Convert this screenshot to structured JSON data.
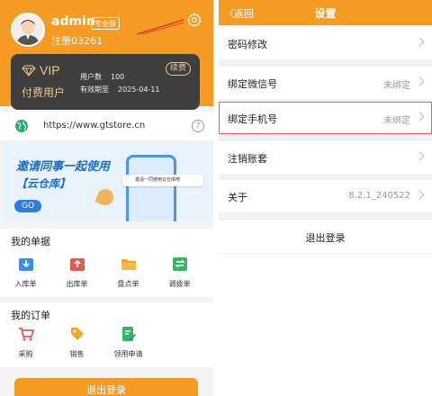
{
  "left": {
    "user": {
      "name": "admin",
      "edition": "专业版",
      "reg_no": "注册03261"
    },
    "vip": {
      "title": "VIP",
      "subtitle": "付费用户",
      "users_label": "用户数",
      "users_value": "100",
      "expire_label": "有效期至",
      "expire_value": "2025-04-11",
      "renew_label": "续费"
    },
    "url": "https://www.gtstore.cn",
    "help_glyph": "?",
    "banner": {
      "line1": "邀请同事一起使用",
      "line2": "【云仓库】",
      "go_label": "GO",
      "tip": "邀请一同使用云仓库吧"
    },
    "documents": {
      "title": "我的单据",
      "items": [
        {
          "label": "入库单",
          "icon": "inbound-icon",
          "color": "#3a8ee6"
        },
        {
          "label": "出库单",
          "icon": "outbound-icon",
          "color": "#e05a4f"
        },
        {
          "label": "盘点单",
          "icon": "folder-icon",
          "color": "#f5a623"
        },
        {
          "label": "调拨单",
          "icon": "transfer-icon",
          "color": "#3bb26b"
        }
      ]
    },
    "orders": {
      "title": "我的订单",
      "items": [
        {
          "label": "采购",
          "icon": "cart-icon",
          "color": "#e05a4f"
        },
        {
          "label": "销售",
          "icon": "tag-icon",
          "color": "#f5a623"
        },
        {
          "label": "领用申请",
          "icon": "edit-doc-icon",
          "color": "#3bb26b"
        }
      ]
    },
    "logout_label": "退出登录"
  },
  "right": {
    "back_label": "返回",
    "title": "设置",
    "rows": [
      {
        "label": "密码修改",
        "value": ""
      },
      {
        "label": "绑定微信号",
        "value": "未绑定"
      },
      {
        "label": "绑定手机号",
        "value": "未绑定"
      },
      {
        "label": "注销账套",
        "value": ""
      },
      {
        "label": "关于",
        "value": "8.2.1_240522"
      }
    ],
    "logout_label": "退出登录"
  },
  "colors": {
    "accent": "#f59a23",
    "vip_card": "#3e3e3e",
    "vip_gold": "#f0c68a",
    "highlight": "#e86060"
  }
}
